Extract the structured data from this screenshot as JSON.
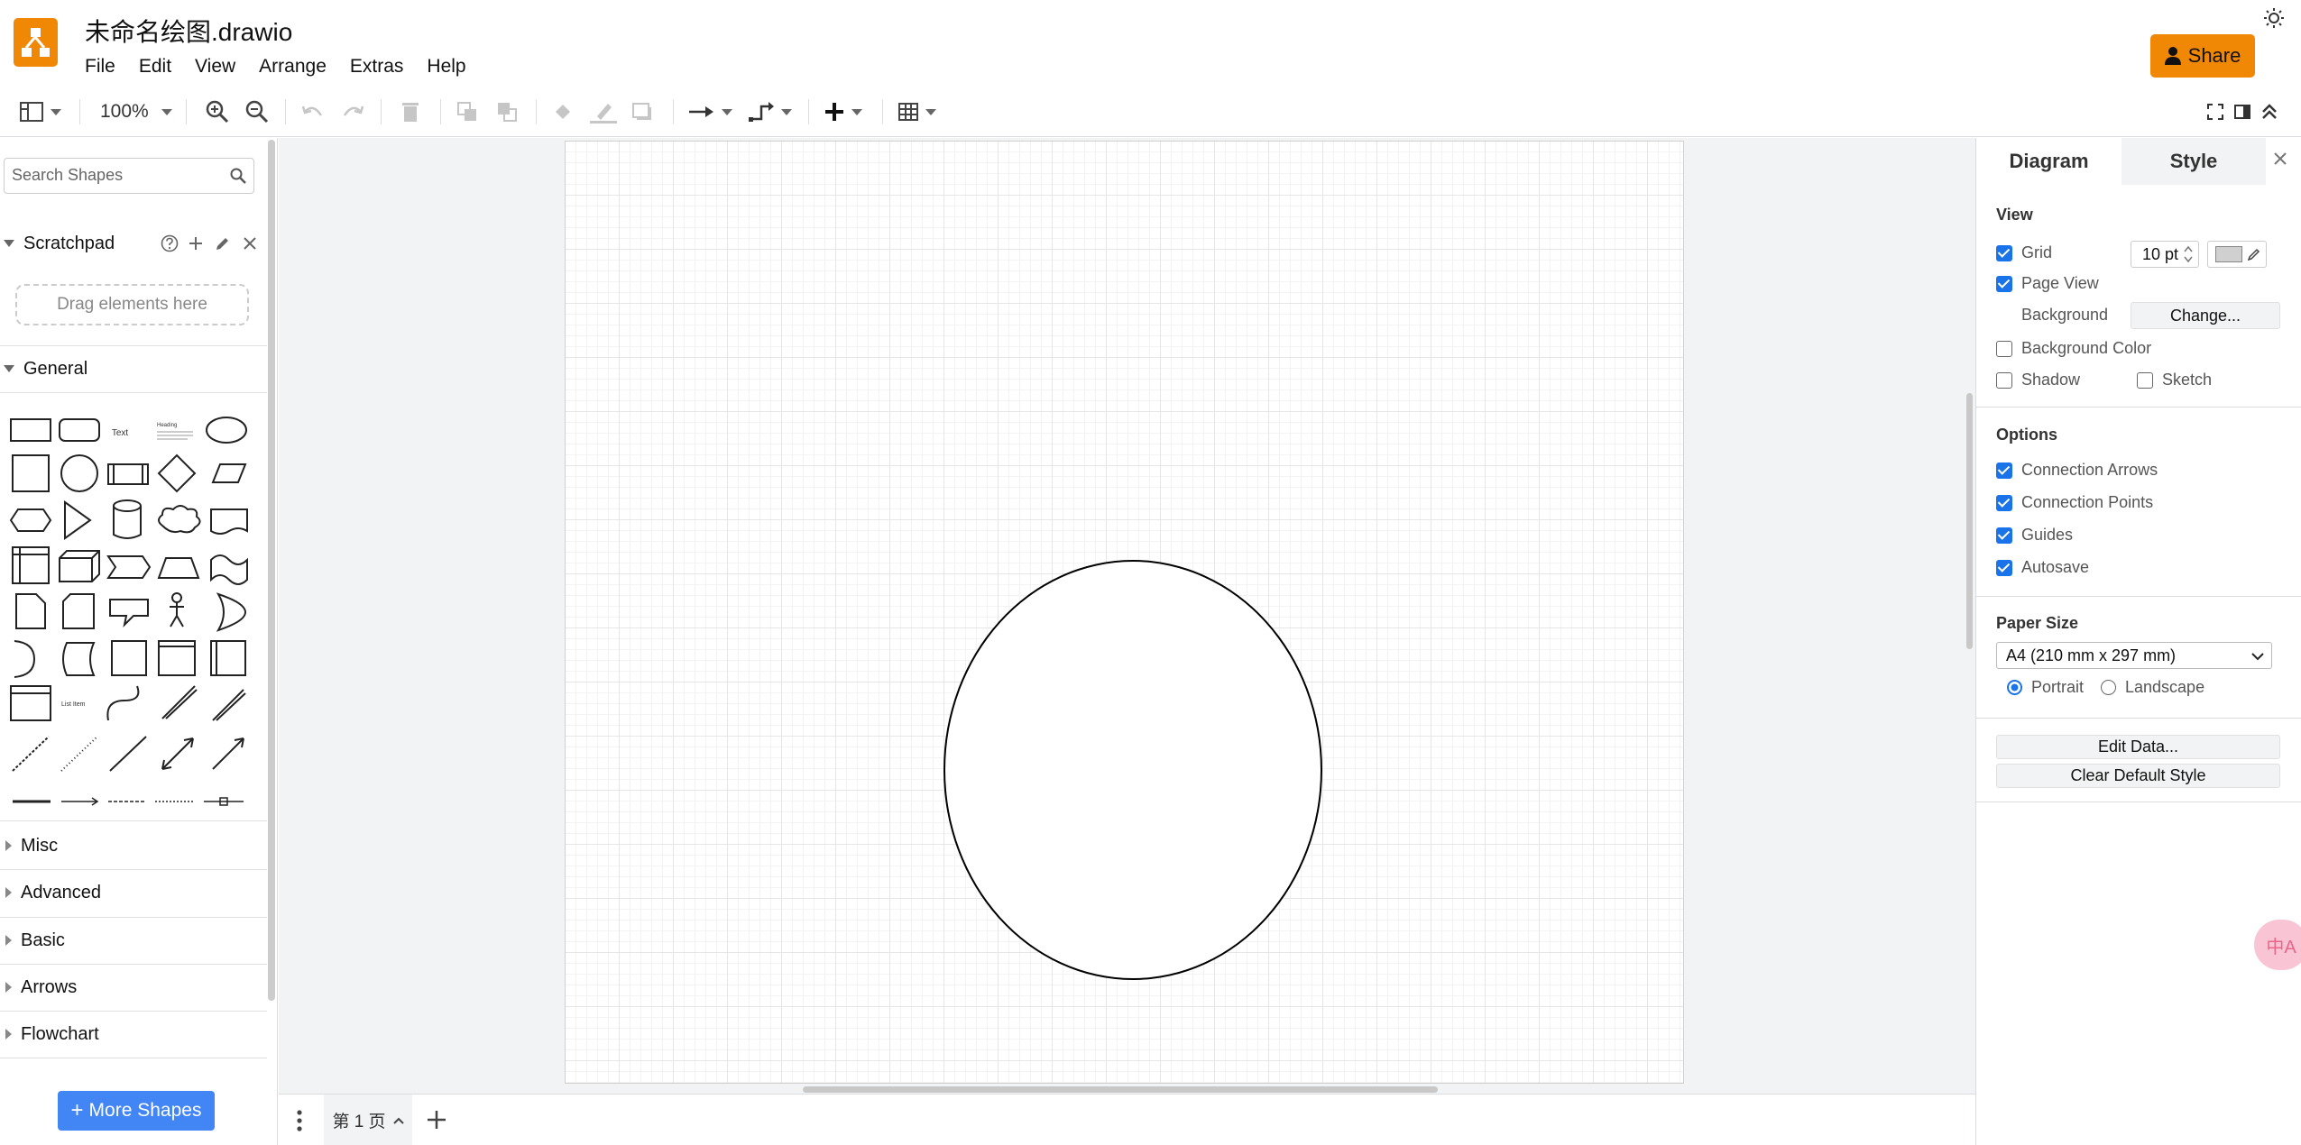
{
  "app": {
    "doc_title": "未命名绘图.drawio",
    "menu": [
      "File",
      "Edit",
      "View",
      "Arrange",
      "Extras",
      "Help"
    ],
    "share_label": "Share",
    "brand_color": "#f08705"
  },
  "toolbar": {
    "zoom": "100%"
  },
  "sidebar": {
    "search_placeholder": "Search Shapes",
    "scratchpad": {
      "title": "Scratchpad",
      "drop_hint": "Drag elements here"
    },
    "general_title": "General",
    "general_shape_text": [
      "Text",
      "Heading",
      "List Item"
    ],
    "collapsed_sections": [
      "Misc",
      "Advanced",
      "Basic",
      "Arrows",
      "Flowchart"
    ],
    "more_shapes_label": "More Shapes",
    "accent_color": "#4285f4"
  },
  "pages": {
    "tabs": [
      {
        "label": "第 1 页"
      }
    ]
  },
  "panel": {
    "tabs": [
      "Diagram",
      "Style"
    ],
    "view": {
      "title": "View",
      "grid_label": "Grid",
      "grid_checked": true,
      "grid_size": "10 pt",
      "grid_color": "#d0d0d0",
      "page_view_label": "Page View",
      "page_view_checked": true,
      "background_label": "Background",
      "change_label": "Change...",
      "background_color_label": "Background Color",
      "background_color_checked": false,
      "shadow_label": "Shadow",
      "shadow_checked": false,
      "sketch_label": "Sketch",
      "sketch_checked": false
    },
    "options": {
      "title": "Options",
      "items": [
        {
          "label": "Connection Arrows",
          "checked": true
        },
        {
          "label": "Connection Points",
          "checked": true
        },
        {
          "label": "Guides",
          "checked": true
        },
        {
          "label": "Autosave",
          "checked": true
        }
      ]
    },
    "paper": {
      "title": "Paper Size",
      "size": "A4 (210 mm x 297 mm)",
      "portrait_label": "Portrait",
      "landscape_label": "Landscape",
      "orientation": "Portrait"
    },
    "edit_data_label": "Edit Data...",
    "clear_style_label": "Clear Default Style"
  },
  "translate_fab": "中A"
}
